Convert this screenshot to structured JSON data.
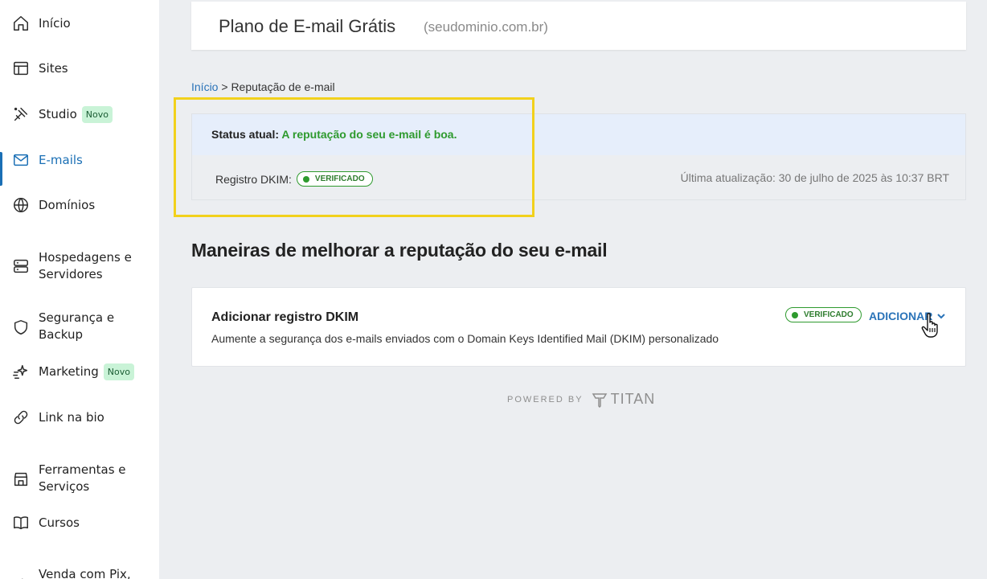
{
  "sidebar": {
    "items": [
      {
        "label": "Início",
        "icon": "home-icon"
      },
      {
        "label": "Sites",
        "icon": "layout-icon"
      },
      {
        "label": "Studio",
        "icon": "studio-icon",
        "badge": "Novo"
      },
      {
        "label": "E-mails",
        "icon": "mail-icon",
        "active": true
      },
      {
        "label": "Domínios",
        "icon": "globe-icon"
      },
      {
        "label": "Hospedagens e Servidores",
        "icon": "server-icon"
      },
      {
        "label": "Segurança e Backup",
        "icon": "shield-icon"
      },
      {
        "label": "Marketing",
        "icon": "sparkle-icon",
        "badge": "Novo"
      },
      {
        "label": "Link na bio",
        "icon": "link-icon"
      },
      {
        "label": "Ferramentas e Serviços",
        "icon": "store-icon"
      },
      {
        "label": "Cursos",
        "icon": "book-icon"
      },
      {
        "label": "Venda com Pix,",
        "icon": "arrow-icon"
      }
    ]
  },
  "header": {
    "title": "Plano de E-mail Grátis",
    "domain": "(seudominio.com.br)"
  },
  "breadcrumb": {
    "home": "Início",
    "separator": " > ",
    "current": "Reputação de e-mail"
  },
  "status": {
    "label": "Status atual:",
    "value": "A reputação do seu e-mail é boa.",
    "dkim_label": "Registro DKIM:",
    "dkim_badge": "VERIFICADO",
    "last_update": "Última atualização: 30 de julho de 2025 às 10:37 BRT"
  },
  "section": {
    "title": "Maneiras de melhorar a reputação do seu e-mail"
  },
  "improve": {
    "title": "Adicionar registro DKIM",
    "description": "Aumente a segurança dos e-mails enviados com o Domain Keys Identified Mail (DKIM) personalizado",
    "badge": "VERIFICADO",
    "action": "ADICIONAR"
  },
  "footer": {
    "powered_by": "POWERED BY",
    "brand": "TITAN"
  },
  "colors": {
    "accent": "#1a6fb5",
    "success": "#2e9a2e",
    "highlight": "#f2d11c",
    "status_bg": "#e6eefb"
  }
}
